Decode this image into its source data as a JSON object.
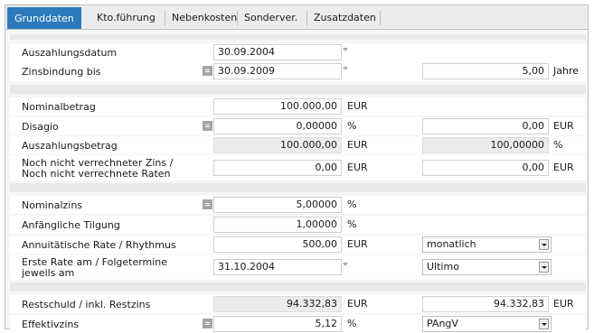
{
  "tabs": [
    {
      "label": "Grunddaten",
      "active": true
    },
    {
      "label": "Kto.führung"
    },
    {
      "label": "Nebenkosten"
    },
    {
      "label": "Sonderver."
    },
    {
      "label": "Zusatzdaten"
    }
  ],
  "rows": {
    "auszahlungsdatum": {
      "label": "Auszahlungsdatum",
      "value": "30.09.2004"
    },
    "zinsbindung": {
      "label": "Zinsbindung bis",
      "value": "30.09.2009",
      "years": "5,00",
      "years_unit": "Jahre"
    },
    "nominalbetrag": {
      "label": "Nominalbetrag",
      "value": "100.000,00",
      "unit": "EUR"
    },
    "disagio": {
      "label": "Disagio",
      "pct": "0,00000",
      "pct_unit": "%",
      "amount": "0,00",
      "amount_unit": "EUR"
    },
    "auszahlungsbetrag": {
      "label": "Auszahlungsbetrag",
      "value": "100.000,00",
      "unit": "EUR",
      "pct": "100,00000",
      "pct_unit": "%"
    },
    "noch_nicht": {
      "label_line1": "Noch nicht verrechneter Zins /",
      "label_line2": "Noch nicht verrechnete Raten",
      "zins": "0,00",
      "zins_unit": "EUR",
      "raten": "0,00",
      "raten_unit": "EUR"
    },
    "nominalzins": {
      "label": "Nominalzins",
      "value": "5,00000",
      "unit": "%"
    },
    "tilgung": {
      "label": "Anfängliche Tilgung",
      "value": "1,00000",
      "unit": "%"
    },
    "annuitaet": {
      "label": "Annuitätische Rate / Rhythmus",
      "value": "500,00",
      "unit": "EUR",
      "rhythm": "monatlich"
    },
    "erste_rate": {
      "label_line1": "Erste Rate am / Folgetermine",
      "label_line2": "jeweils am",
      "value": "31.10.2004",
      "folge": "Ultimo"
    },
    "restschuld": {
      "label": "Restschuld / inkl. Restzins",
      "value": "94.332,83",
      "unit": "EUR",
      "inkl": "94.332,83",
      "inkl_unit": "EUR"
    },
    "effektivzins": {
      "label": "Effektivzins",
      "value": "5,12",
      "unit": "%",
      "method": "PAngV"
    }
  }
}
